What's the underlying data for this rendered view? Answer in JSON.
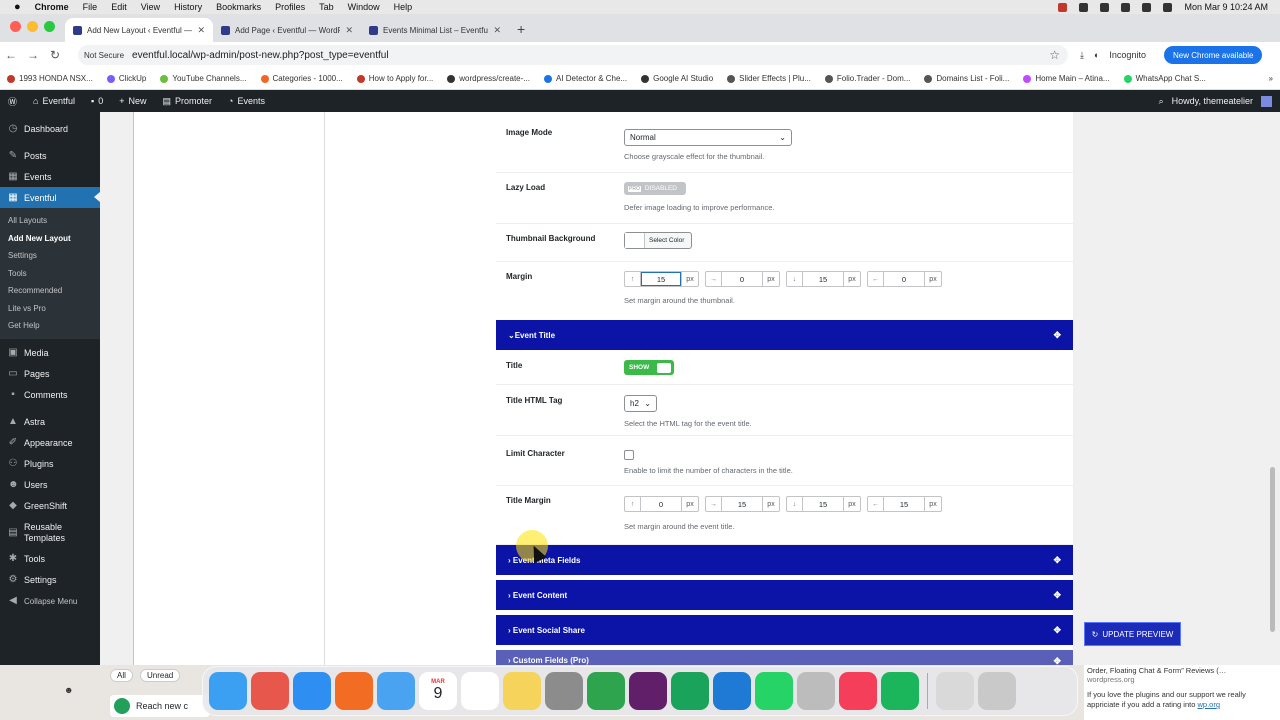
{
  "mac_menu": {
    "app": "Chrome",
    "items": [
      "File",
      "Edit",
      "View",
      "History",
      "Bookmarks",
      "Profiles",
      "Tab",
      "Window",
      "Help"
    ],
    "datetime": "Mon Mar 9  10:24 AM"
  },
  "tabs": [
    {
      "title": "Add New Layout ‹ Eventful —",
      "active": true
    },
    {
      "title": "Add Page ‹ Eventful — WordP",
      "active": false
    },
    {
      "title": "Events Minimal List – Eventfu",
      "active": false
    }
  ],
  "url": {
    "security": "Not Secure",
    "address": "eventful.local/wp-admin/post-new.php?post_type=eventful",
    "incognito": "Incognito",
    "new_chrome": "New Chrome available"
  },
  "bookmarks": [
    "1993 HONDA NSX...",
    "ClickUp",
    "YouTube Channels...",
    "Categories - 1000...",
    "How to Apply for...",
    "wordpress/create-...",
    "AI Detector & Che...",
    "Google AI Studio",
    "Slider Effects | Plu...",
    "Folio.Trader - Dom...",
    "Domains List - Foli...",
    "Home Main – Atina...",
    "WhatsApp Chat S..."
  ],
  "adminbar": {
    "site": "Eventful",
    "comments": "0",
    "new": "New",
    "promoter": "Promoter",
    "events": "Events",
    "howdy": "Howdy, themeatelier"
  },
  "sidebar": {
    "top": [
      {
        "label": "Dashboard",
        "icon": "dashboard-icon"
      },
      {
        "label": "Posts",
        "icon": "pin-icon"
      },
      {
        "label": "Events",
        "icon": "calendar-icon"
      }
    ],
    "current": {
      "label": "Eventful",
      "icon": "grid-icon"
    },
    "sub": [
      "All Layouts",
      "Add New Layout",
      "Settings",
      "Tools",
      "Recommended",
      "Lite vs Pro",
      "Get Help"
    ],
    "bottom": [
      {
        "label": "Media",
        "icon": "media-icon"
      },
      {
        "label": "Pages",
        "icon": "page-icon"
      },
      {
        "label": "Comments",
        "icon": "comment-icon"
      },
      {
        "label": "Astra",
        "icon": "astra-icon"
      },
      {
        "label": "Appearance",
        "icon": "brush-icon"
      },
      {
        "label": "Plugins",
        "icon": "plugin-icon"
      },
      {
        "label": "Users",
        "icon": "user-icon"
      },
      {
        "label": "GreenShift",
        "icon": "greenshift-icon"
      },
      {
        "label": "Reusable Templates",
        "icon": "template-icon"
      },
      {
        "label": "Tools",
        "icon": "wrench-icon"
      },
      {
        "label": "Settings",
        "icon": "settings-icon"
      },
      {
        "label": "Collapse Menu",
        "icon": "collapse-icon"
      }
    ]
  },
  "panel": {
    "image_mode": {
      "label": "Image Mode",
      "value": "Normal",
      "desc": "Choose grayscale effect for the thumbnail."
    },
    "lazy_load": {
      "label": "Lazy Load",
      "badge": "PRO",
      "state": "DISABLED",
      "desc": "Defer image loading to improve performance."
    },
    "thumb_bg": {
      "label": "Thumbnail Background",
      "button": "Select Color"
    },
    "margin": {
      "label": "Margin",
      "values": [
        "15",
        "0",
        "15",
        "0"
      ],
      "unit": "px",
      "desc": "Set margin around the thumbnail."
    },
    "event_title_section": "Event Title",
    "title": {
      "label": "Title",
      "toggle": "SHOW"
    },
    "title_tag": {
      "label": "Title HTML Tag",
      "value": "h2",
      "desc": "Select the HTML tag for the event title."
    },
    "limit_char": {
      "label": "Limit Character",
      "desc": "Enable to limit the number of characters in the title."
    },
    "title_margin": {
      "label": "Title Margin",
      "values": [
        "0",
        "15",
        "15",
        "15"
      ],
      "unit": "px",
      "desc": "Set margin around the event title."
    },
    "sections": [
      "Event Meta Fields",
      "Event Content",
      "Event Social Share",
      "Custom Fields (Pro)"
    ],
    "update_preview": "UPDATE PREVIEW"
  },
  "bottom": {
    "tab_all": "All",
    "tab_unread": "Unread",
    "reach": "Reach new c",
    "wp_title": "Order, Floating Chat & Form” Reviews (…",
    "wp_domain": "wordpress.org",
    "wp_text": "If you love the plugins and our support we really appriciate if you add a rating into",
    "wp_link": "wp.org"
  },
  "dock": {
    "calendar_month": "MAR",
    "calendar_day": "9"
  }
}
